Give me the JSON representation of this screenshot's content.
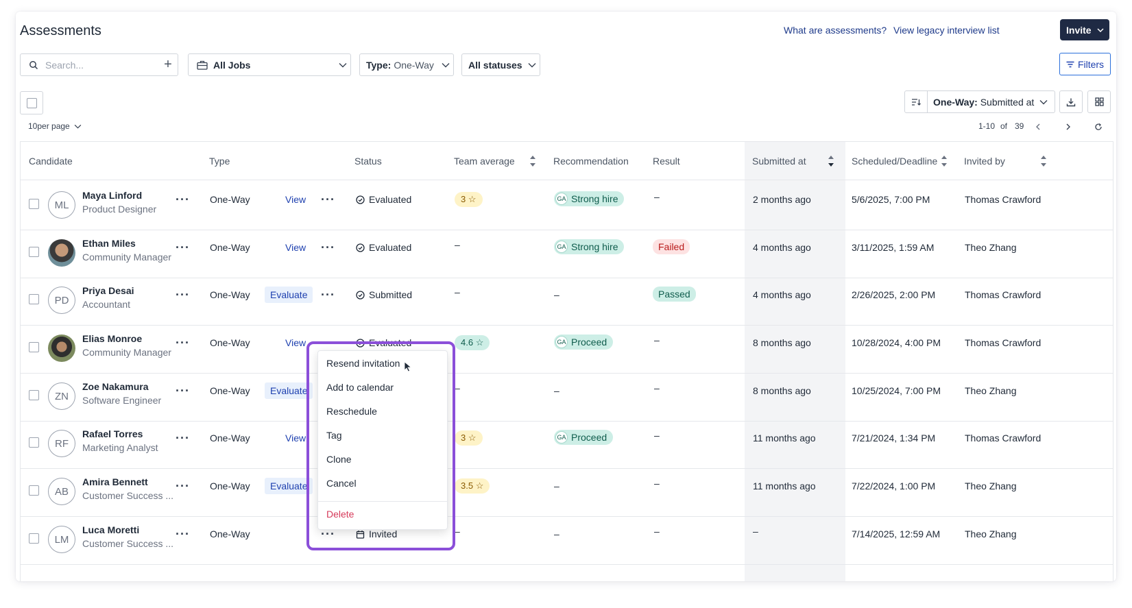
{
  "header": {
    "title": "Assessments",
    "link_what": "What are assessments?",
    "link_legacy": "View legacy interview list",
    "invite_label": "Invite"
  },
  "filters": {
    "search_placeholder": "Search...",
    "jobs_label": "All Jobs",
    "type_prefix": "Type:",
    "type_value": "One-Way",
    "status_label": "All statuses",
    "filters_label": "Filters"
  },
  "toolbar": {
    "sort_prefix": "One-Way:",
    "sort_value": "Submitted at",
    "per_page_value": "10",
    "per_page_suffix": "per page",
    "range": "1-10",
    "of": "of",
    "total": "39"
  },
  "columns": {
    "candidate": "Candidate",
    "type": "Type",
    "status": "Status",
    "team_average": "Team average",
    "recommendation": "Recommendation",
    "result": "Result",
    "submitted_at": "Submitted at",
    "scheduled": "Scheduled/Deadline",
    "invited_by": "Invited by"
  },
  "rows": [
    {
      "initials": "ML",
      "name": "Maya Linford",
      "role": "Product Designer",
      "type": "One-Way",
      "action": "View",
      "status": "Evaluated",
      "team_avg": "3",
      "rec": "Strong hire",
      "rec_ga": "GA",
      "result": "–",
      "submitted": "2 months ago",
      "scheduled": "5/6/2025, 7:00 PM",
      "invited_by": "Thomas Crawford"
    },
    {
      "initials": "",
      "name": "Ethan Miles",
      "role": "Community Manager",
      "type": "One-Way",
      "action": "View",
      "status": "Evaluated",
      "team_avg": "–",
      "rec": "Strong hire",
      "rec_ga": "GA",
      "result": "Failed",
      "submitted": "4 months ago",
      "scheduled": "3/11/2025, 1:59 AM",
      "invited_by": "Theo Zhang"
    },
    {
      "initials": "PD",
      "name": "Priya Desai",
      "role": "Accountant",
      "type": "One-Way",
      "action": "Evaluate",
      "status": "Submitted",
      "team_avg": "–",
      "rec": "–",
      "result": "Passed",
      "submitted": "4 months ago",
      "scheduled": "2/26/2025, 2:00 PM",
      "invited_by": "Thomas Crawford"
    },
    {
      "initials": "",
      "name": "Elias Monroe",
      "role": "Community Manager",
      "type": "One-Way",
      "action": "View",
      "status": "Evaluated",
      "team_avg": "4.6",
      "rec": "Proceed",
      "rec_ga": "GA",
      "result": "–",
      "submitted": "8 months ago",
      "scheduled": "10/28/2024, 4:00 PM",
      "invited_by": "Thomas Crawford"
    },
    {
      "initials": "ZN",
      "name": "Zoe Nakamura",
      "role": "Software Engineer",
      "type": "One-Way",
      "action": "Evaluate",
      "status": "",
      "team_avg": "–",
      "rec": "–",
      "result": "–",
      "submitted": "8 months ago",
      "scheduled": "10/25/2024, 7:00 PM",
      "invited_by": "Theo Zhang"
    },
    {
      "initials": "RF",
      "name": "Rafael Torres",
      "role": "Marketing Analyst",
      "type": "One-Way",
      "action": "View",
      "status": "",
      "team_avg": "3",
      "rec": "Proceed",
      "rec_ga": "GA",
      "result": "–",
      "submitted": "11 months ago",
      "scheduled": "7/21/2024, 1:34 PM",
      "invited_by": "Thomas Crawford"
    },
    {
      "initials": "AB",
      "name": "Amira Bennett",
      "role": "Customer Success ...",
      "type": "One-Way",
      "action": "Evaluate",
      "status": "",
      "team_avg": "3.5",
      "rec": "–",
      "result": "–",
      "submitted": "11 months ago",
      "scheduled": "7/22/2024, 1:00 PM",
      "invited_by": "Theo Zhang"
    },
    {
      "initials": "LM",
      "name": "Luca Moretti",
      "role": "Customer Success ...",
      "type": "One-Way",
      "action": "",
      "status": "Invited",
      "team_avg": "–",
      "rec": "–",
      "result": "–",
      "submitted": "–",
      "scheduled": "7/14/2025, 12:59 AM",
      "invited_by": "Theo Zhang"
    }
  ],
  "menu": {
    "resend": "Resend invitation",
    "calendar": "Add to calendar",
    "reschedule": "Reschedule",
    "tag": "Tag",
    "clone": "Clone",
    "cancel": "Cancel",
    "delete": "Delete"
  },
  "colors": {
    "accent": "#1f2a44",
    "highlight": "#8b4fd9",
    "link": "#1e40af",
    "danger": "#d63a5a"
  }
}
